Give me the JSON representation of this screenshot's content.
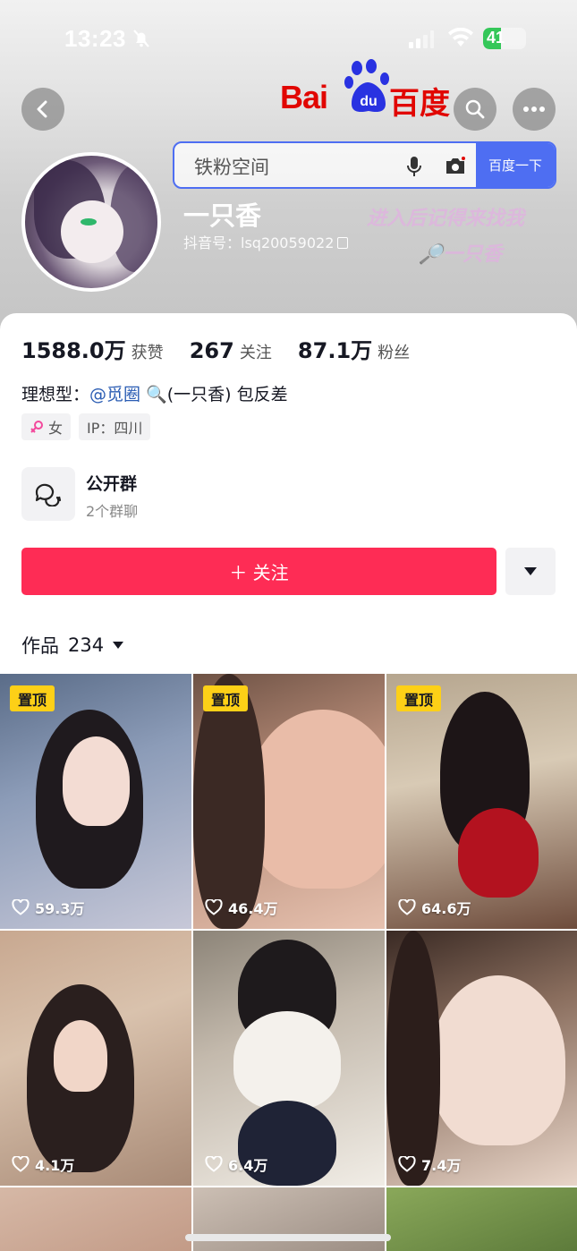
{
  "status_bar": {
    "time": "13:23",
    "battery_level": "41",
    "battery_fraction": 0.41
  },
  "header": {
    "baidu": {
      "logo_latin": "Bai",
      "logo_paw_text": "du",
      "logo_cn": "百度",
      "search_placeholder": "铁粉空间",
      "search_button": "百度一下"
    },
    "nickname": "一只香",
    "douyin_id": "抖音号：lsq20059022",
    "watermark_line1": "进入后记得来找我",
    "watermark_line2": "🔎一只香"
  },
  "stats": [
    {
      "value": "1588.0万",
      "label": "获赞"
    },
    {
      "value": "267",
      "label": "关注"
    },
    {
      "value": "87.1万",
      "label": "粉丝"
    }
  ],
  "bio": {
    "prefix": "理想型：",
    "mention": "@觅圈",
    "suffix": "🔍(一只香) 包反差"
  },
  "tags": {
    "gender": "女",
    "ip": "IP：四川"
  },
  "group": {
    "title": "公开群",
    "subtitle": "2个群聊"
  },
  "follow_button": "＋ 关注",
  "works": {
    "label": "作品",
    "count": "234"
  },
  "videos": [
    {
      "pinned": true,
      "pin_label": "置顶",
      "likes": "59.3万"
    },
    {
      "pinned": true,
      "pin_label": "置顶",
      "likes": "46.4万"
    },
    {
      "pinned": true,
      "pin_label": "置顶",
      "likes": "64.6万"
    },
    {
      "pinned": false,
      "pin_label": "",
      "likes": "4.1万"
    },
    {
      "pinned": false,
      "pin_label": "",
      "likes": "6.4万"
    },
    {
      "pinned": false,
      "pin_label": "",
      "likes": "7.4万"
    }
  ],
  "colors": {
    "accent": "#fe2c55",
    "baidu_red": "#e10601",
    "baidu_blue": "#4e6ef2",
    "pin_yellow": "#fdd017",
    "mention_blue": "#2a5cb3"
  },
  "icons": {
    "back": "chevron-left-icon",
    "search": "search-icon",
    "more": "more-dots-icon",
    "group": "chat-bubbles-icon",
    "dropdown": "triangle-down-icon",
    "like": "heart-outline-icon",
    "gender": "female-icon",
    "mute": "bell-slash-icon"
  }
}
